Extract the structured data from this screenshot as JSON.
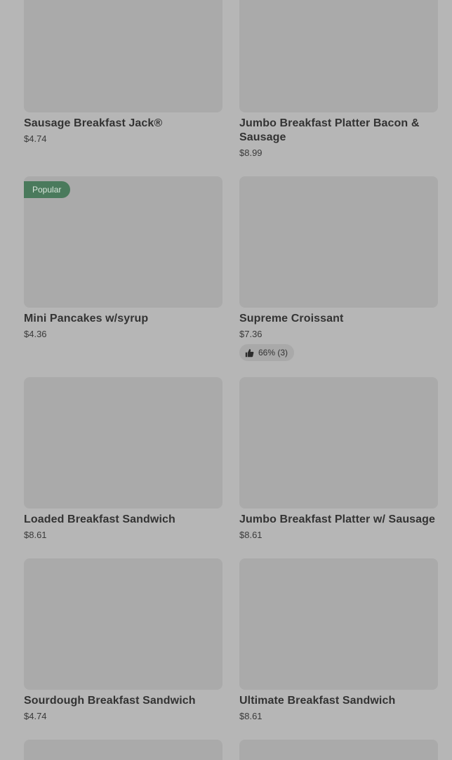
{
  "items": [
    {
      "name": "Sausage Breakfast Jack®",
      "price": "$4.74"
    },
    {
      "name": "Jumbo Breakfast Platter Bacon & Sausage",
      "price": "$8.99"
    },
    {
      "name": "Mini Pancakes w/syrup",
      "price": "$4.36",
      "badge": "Popular"
    },
    {
      "name": "Supreme Croissant",
      "price": "$7.36",
      "rating": "66% (3)"
    },
    {
      "name": "Loaded Breakfast Sandwich",
      "price": "$8.61"
    },
    {
      "name": "Jumbo Breakfast Platter w/ Sausage",
      "price": "$8.61"
    },
    {
      "name": "Sourdough Breakfast Sandwich",
      "price": "$4.74"
    },
    {
      "name": "Ultimate Breakfast Sandwich",
      "price": "$8.61"
    }
  ],
  "colors": {
    "badge_bg": "#4a7a5c",
    "overlay": "#b6b6b6",
    "image_placeholder": "#aaaaaa"
  },
  "icons": {
    "rating": "thumbs-up-icon"
  }
}
